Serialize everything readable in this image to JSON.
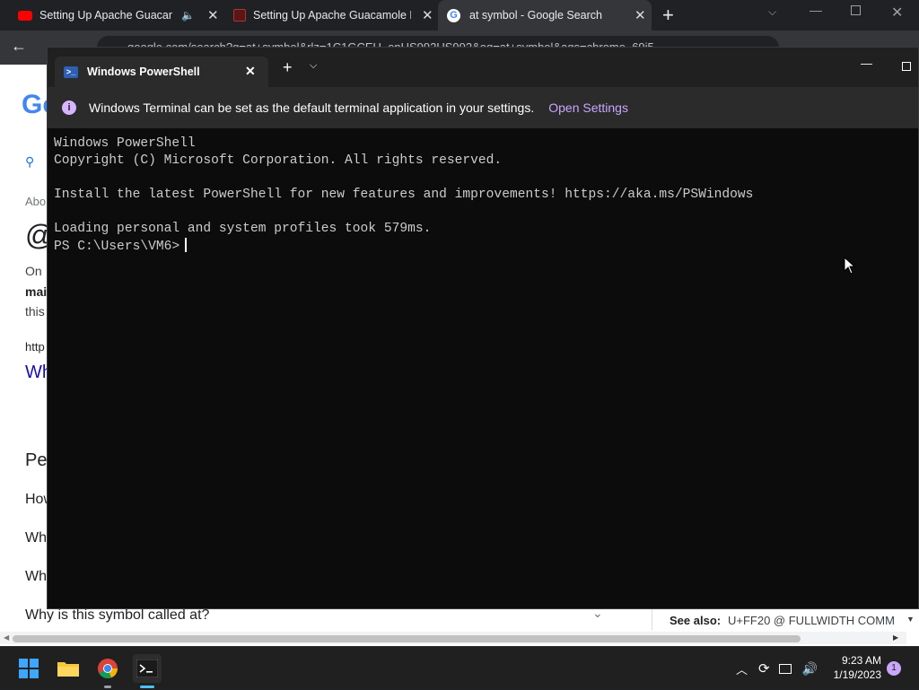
{
  "chrome": {
    "tabs": [
      {
        "title": "Setting Up Apache Guacamole"
      },
      {
        "title": "Setting Up Apache Guacamole LI"
      },
      {
        "title": "at symbol - Google Search"
      }
    ],
    "new_tab": "+",
    "omnibox_url": "google.com/search?q=at+symbol&rlz=1C1GCEU_enUS992US992&oq=at+symbol&aqs=chrome..69i5"
  },
  "google_page": {
    "fragments": {
      "logo": "Go",
      "about": "Abo",
      "at_glyph": "@",
      "on": "On",
      "mail": "mai",
      "this": "this",
      "http": "http",
      "wh_link": "Wh",
      "pe": "Pe",
      "how": "How",
      "wh1": "Wh",
      "wh2": "Wh"
    },
    "question": "Why is this symbol called at?",
    "see_also_label": "See also:",
    "see_also_value": "U+FF20 @ FULLWIDTH COMM"
  },
  "terminal": {
    "tab_title": "Windows PowerShell",
    "new_tab": "+",
    "infobar_message": "Windows Terminal can be set as the default terminal application in your settings.",
    "infobar_link": "Open Settings",
    "lines": [
      "Windows PowerShell",
      "Copyright (C) Microsoft Corporation. All rights reserved.",
      "",
      "Install the latest PowerShell for new features and improvements! https://aka.ms/PSWindows",
      "",
      "Loading personal and system profiles took 579ms."
    ],
    "prompt": "PS C:\\Users\\VM6>"
  },
  "taskbar": {
    "time": "9:23 AM",
    "date": "1/19/2023",
    "notification_count": "1"
  },
  "colors": {
    "terminal_bg": "#0c0c0c",
    "terminal_text": "#cccccc",
    "infobar_link": "#c9a6ff",
    "google_blue": "#1a0dab"
  }
}
